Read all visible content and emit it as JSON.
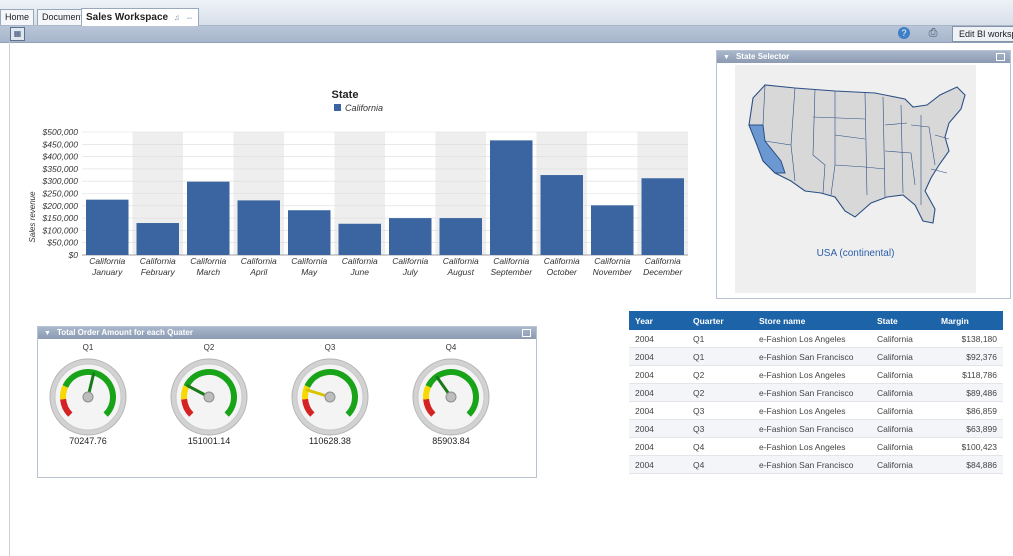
{
  "tabs": {
    "home": "Home",
    "documents": "Documents",
    "active": "Sales Workspace"
  },
  "toolbar": {
    "edit_label": "Edit BI workspace"
  },
  "state_selector": {
    "title": "State Selector",
    "map_label": "USA (continental)"
  },
  "gauges_panel": {
    "title": "Total Order Amount for each Quater",
    "gauges": [
      {
        "name": "Q1",
        "value": "70247.76",
        "level": 0.55
      },
      {
        "name": "Q2",
        "value": "151001.14",
        "level": 0.27
      },
      {
        "name": "Q3",
        "value": "110628.38",
        "level": 0.23
      },
      {
        "name": "Q4",
        "value": "85903.84",
        "level": 0.37
      }
    ]
  },
  "table": {
    "headers": [
      "Year",
      "Quarter",
      "Store name",
      "State",
      "Margin"
    ],
    "rows": [
      [
        "2004",
        "Q1",
        "e-Fashion Los Angeles",
        "California",
        "$138,180"
      ],
      [
        "2004",
        "Q1",
        "e-Fashion San Francisco",
        "California",
        "$92,376"
      ],
      [
        "2004",
        "Q2",
        "e-Fashion Los Angeles",
        "California",
        "$118,786"
      ],
      [
        "2004",
        "Q2",
        "e-Fashion San Francisco",
        "California",
        "$89,486"
      ],
      [
        "2004",
        "Q3",
        "e-Fashion Los Angeles",
        "California",
        "$86,859"
      ],
      [
        "2004",
        "Q3",
        "e-Fashion San Francisco",
        "California",
        "$63,899"
      ],
      [
        "2004",
        "Q4",
        "e-Fashion Los Angeles",
        "California",
        "$100,423"
      ],
      [
        "2004",
        "Q4",
        "e-Fashion San Francisco",
        "California",
        "$84,886"
      ]
    ]
  },
  "chart_data": {
    "type": "bar",
    "title": "State",
    "legend": [
      "California"
    ],
    "legend_position": "top",
    "ylabel": "Sales revenue",
    "xlabel": "",
    "ylim": [
      0,
      500000
    ],
    "y_ticks": [
      "$0",
      "$50,000",
      "$100,000",
      "$150,000",
      "$200,000",
      "$250,000",
      "$300,000",
      "$350,000",
      "$400,000",
      "$450,000",
      "$500,000"
    ],
    "categories": [
      [
        "California",
        "January"
      ],
      [
        "California",
        "February"
      ],
      [
        "California",
        "March"
      ],
      [
        "California",
        "April"
      ],
      [
        "California",
        "May"
      ],
      [
        "California",
        "June"
      ],
      [
        "California",
        "July"
      ],
      [
        "California",
        "August"
      ],
      [
        "California",
        "September"
      ],
      [
        "California",
        "October"
      ],
      [
        "California",
        "November"
      ],
      [
        "California",
        "December"
      ]
    ],
    "series": [
      {
        "name": "California",
        "values": [
          225000,
          130000,
          298000,
          222000,
          182000,
          127000,
          150000,
          150000,
          466000,
          325000,
          202000,
          312000
        ]
      }
    ],
    "bar_color": "#3a65a0",
    "grid": true
  }
}
